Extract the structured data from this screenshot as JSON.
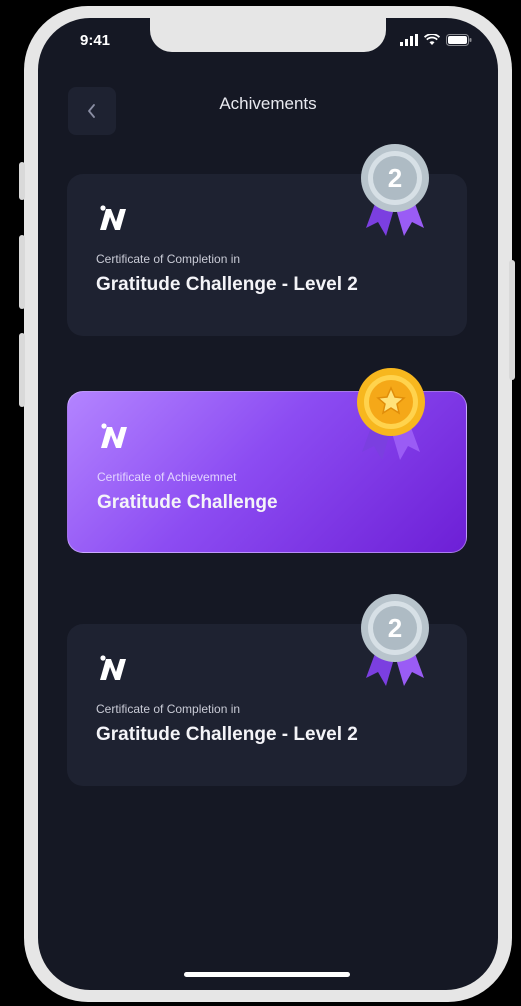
{
  "status_bar": {
    "time": "9:41"
  },
  "header": {
    "title": "Achivements",
    "back_icon": "chevron-left-icon"
  },
  "certificates": [
    {
      "subtitle": "Certificate of Completion in",
      "title": "Gratitude Challenge - Level 2",
      "medal": "silver-medal-2-icon",
      "highlighted": false
    },
    {
      "subtitle": "Certificate of Achievemnet",
      "title": "Gratitude Challenge",
      "medal": "gold-star-medal-icon",
      "highlighted": true
    },
    {
      "subtitle": "Certificate of Completion in",
      "title": "Gratitude Challenge - Level 2",
      "medal": "silver-medal-2-icon",
      "highlighted": false
    }
  ],
  "medal_number": "2",
  "colors": {
    "background": "#151824",
    "card": "#1e2231",
    "accent_purple": "#8c4cf2",
    "ribbon_purple": "#7b3fe0",
    "silver": "#b8c4cc",
    "gold": "#f7b71e"
  }
}
